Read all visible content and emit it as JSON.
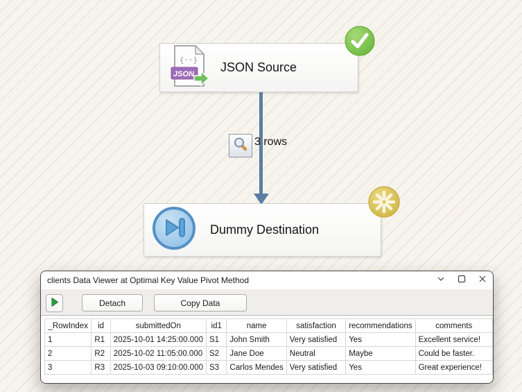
{
  "pipeline": {
    "source": {
      "label": "JSON Source",
      "status": "success",
      "status_icon": "check-badge-icon",
      "type_icon": "json-file-icon"
    },
    "connector": {
      "row_count": "3 rows",
      "icon": "magnifier-icon"
    },
    "destination": {
      "label": "Dummy Destination",
      "status": "running",
      "status_icon": "spinner-badge-icon",
      "type_icon": "skip-end-icon"
    }
  },
  "viewer": {
    "title": "clients Data Viewer at Optimal Key Value Pivot Method",
    "window_controls": [
      "minimize",
      "maximize",
      "close"
    ],
    "toolbar": {
      "play_icon": "play-icon",
      "detach_label": "Detach",
      "copy_label": "Copy Data"
    },
    "table": {
      "columns": [
        "_RowIndex",
        "id",
        "submittedOn",
        "id1",
        "name",
        "satisfaction",
        "recommendations",
        "comments"
      ],
      "rows": [
        [
          "1",
          "R1",
          "2025-10-01 14:25:00.000",
          "S1",
          "John Smith",
          "Very satisfied",
          "Yes",
          "Excellent service!"
        ],
        [
          "2",
          "R2",
          "2025-10-02 11:05:00.000",
          "S2",
          "Jane Doe",
          "Neutral",
          "Maybe",
          "Could be faster."
        ],
        [
          "3",
          "R3",
          "2025-10-03 09:10:00.000",
          "S3",
          "Carlos Mendes",
          "Very satisfied",
          "Yes",
          "Great experience!"
        ]
      ]
    }
  },
  "colors": {
    "arrow": "#5b7da3",
    "success_green": "#6cbb3c",
    "running_gold": "#d2b544",
    "json_purple": "#9e6cb8",
    "destination_blue": "#8ec2e8",
    "canvas_bg": "#f7f4ee"
  }
}
